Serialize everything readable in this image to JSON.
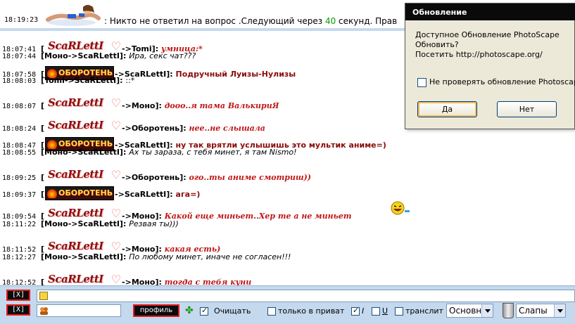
{
  "chat": {
    "system": {
      "time": "18:19:23",
      "pre": ": Никто не ответил на вопрос .Следующий через ",
      "seconds": "40",
      "post": " секунд. Прав"
    },
    "lines": [
      {
        "time": "18:07:41",
        "from": "ScaRLettI",
        "to": "Tomi",
        "text": "умница:*",
        "style": "m-red",
        "logo": "scar"
      },
      {
        "time": "18:07:44",
        "from": "Моно",
        "to": "ScaRLettI",
        "text": "Ира, секс чат???",
        "style": "m-ital",
        "logo": ""
      },
      {
        "time": "18:07:58",
        "from": "Оборотень",
        "to": "ScaRLettI",
        "text": "Подручный Луизы-Нулизы",
        "style": "m-darkred",
        "logo": "obor"
      },
      {
        "time": "18:08:03",
        "from": "Tomi",
        "to": "ScaRLettI",
        "text": "::*",
        "style": "",
        "logo": ""
      },
      {
        "time": "18:08:07",
        "from": "ScaRLettI",
        "to": "Моно",
        "text": "дооо..я тама ВалькириЯ",
        "style": "m-red",
        "logo": "scar"
      },
      {
        "time": "18:08:24",
        "from": "ScaRLettI",
        "to": "Оборотень",
        "text": "нее..не слышала",
        "style": "m-red",
        "logo": "scar"
      },
      {
        "time": "18:08:47",
        "from": "Оборотень",
        "to": "ScaRLettI",
        "text": "ну так врятли услышишь это мультик аниме=)",
        "style": "m-darkred",
        "logo": "obor"
      },
      {
        "time": "18:08:55",
        "from": "Моно",
        "to": "ScaRLettI",
        "text": "Ах ты зараза, с тебя минет, я там Nismo!",
        "style": "m-ital",
        "logo": ""
      },
      {
        "time": "18:09:25",
        "from": "ScaRLettI",
        "to": "Оборотень",
        "text": "ого..ты аниме смотриш))",
        "style": "m-red",
        "logo": "scar"
      },
      {
        "time": "18:09:37",
        "from": "Оборотень",
        "to": "ScaRLettI",
        "text": "ага=)",
        "style": "m-darkred",
        "logo": "obor"
      },
      {
        "time": "18:09:54",
        "from": "ScaRLettI",
        "to": "Моно",
        "text": "Какой еще миньет..Хер те а не миньет",
        "style": "m-red",
        "logo": "scar"
      },
      {
        "time": "18:11:22",
        "from": "Моно",
        "to": "ScaRLettI",
        "text": "Резвая ты)))",
        "style": "m-ital",
        "logo": ""
      },
      {
        "time": "18:11:52",
        "from": "ScaRLettI",
        "to": "Моно",
        "text": "какая есть)",
        "style": "m-red",
        "logo": "scar"
      },
      {
        "time": "18:12:27",
        "from": "Моно",
        "to": "ScaRLettI",
        "text": "По любому минет, иначе не согласен!!!",
        "style": "m-ital",
        "logo": ""
      },
      {
        "time": "18:12:52",
        "from": "ScaRLettI",
        "to": "Моно",
        "text": "тогда с тебя куни",
        "style": "m-red",
        "logo": "scar"
      }
    ],
    "logo_scar_text": "ScaRLettI",
    "logo_obor_text": "ОБОРОТЕНЬ"
  },
  "toolbar": {
    "close1": "[X]",
    "close2": "[X]",
    "profile": "профиль",
    "clear_label": "Очищать",
    "private_label": "только в приват",
    "italic_label": "I",
    "underline_label": "U",
    "translit_label": "транслит",
    "font_select": "Основн",
    "slippers_select": "Слапы"
  },
  "dialog": {
    "title": "Обновление",
    "line1": "Доступное Обновление PhotoScape",
    "line2": "Обновить?",
    "line3": "Посетить http://photoscape.org/",
    "checkbox": "Не проверять обновление Photoscape",
    "ok": "Да",
    "no": "Нет"
  },
  "colors": {
    "accent_bar": "#c4d8ee",
    "dialog_title": "#0a0a0a",
    "red_text": "#c01616"
  }
}
